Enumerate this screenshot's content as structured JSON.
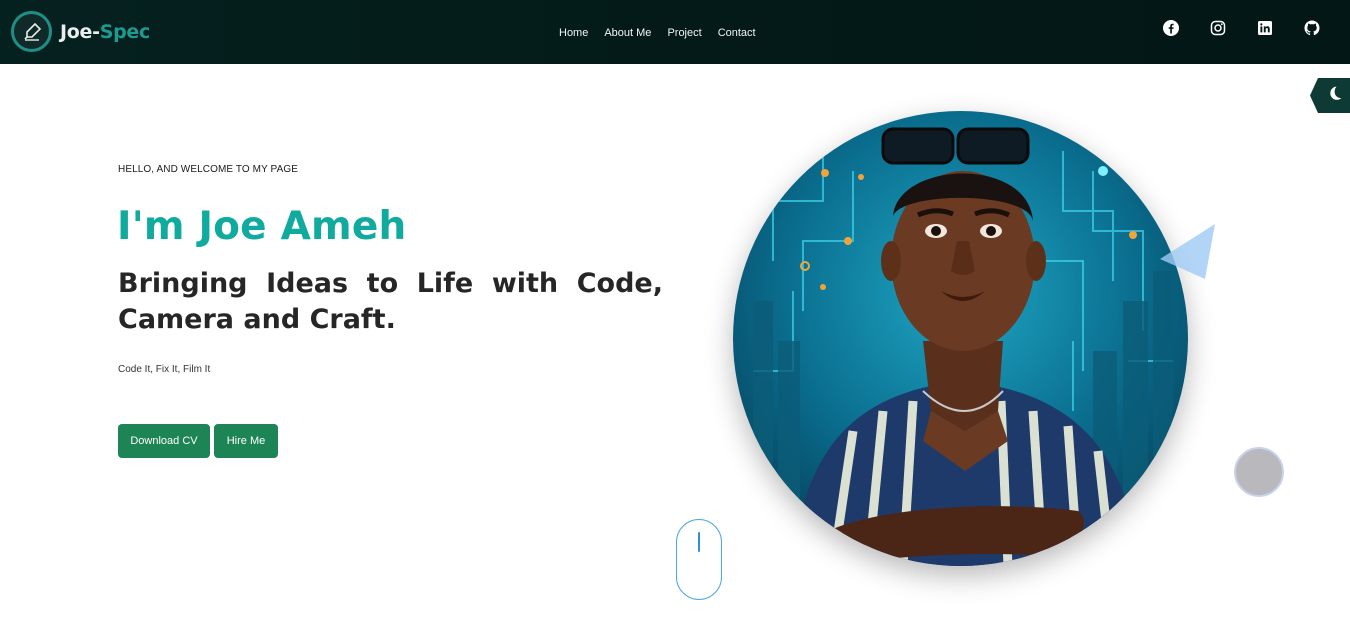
{
  "brand": {
    "name_primary": "Joe-",
    "name_accent": "Spec",
    "logo_icon": "pen-nib-icon"
  },
  "nav": {
    "links": [
      {
        "label": "Home"
      },
      {
        "label": "About Me"
      },
      {
        "label": "Project"
      },
      {
        "label": "Contact"
      }
    ]
  },
  "socials": [
    {
      "icon": "facebook-icon"
    },
    {
      "icon": "instagram-icon"
    },
    {
      "icon": "linkedin-icon"
    },
    {
      "icon": "github-icon"
    }
  ],
  "theme_toggle": {
    "icon": "moon-icon"
  },
  "hero": {
    "greeting": "HELLO, AND WELCOME TO MY PAGE",
    "name": "I'm Joe Ameh",
    "tagline": "Bringing Ideas to Life with Code, Camera and Craft.",
    "subtitle": "Code It, Fix It, Film It",
    "buttons": {
      "download_cv": "Download CV",
      "hire_me": "Hire Me"
    }
  },
  "colors": {
    "navbar_bg": "#031a18",
    "accent": "#10ab9e",
    "button_bg": "#1c8455",
    "text_dark": "#262626"
  }
}
